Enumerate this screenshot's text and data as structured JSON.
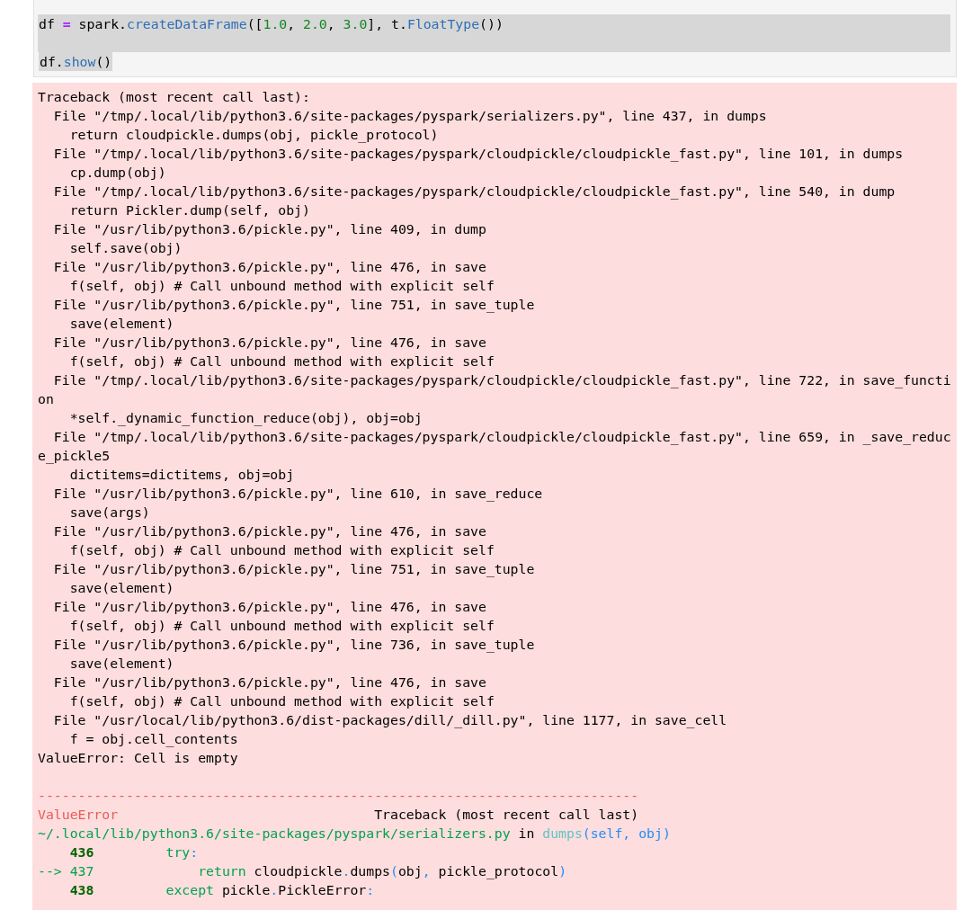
{
  "input_cell": {
    "lines": [
      [
        {
          "text": "df ",
          "kind": "plain"
        },
        {
          "text": "=",
          "kind": "operator"
        },
        {
          "text": " spark.",
          "kind": "plain"
        },
        {
          "text": "createDataFrame",
          "kind": "name"
        },
        {
          "text": "([",
          "kind": "plain"
        },
        {
          "text": "1.0",
          "kind": "number"
        },
        {
          "text": ", ",
          "kind": "plain"
        },
        {
          "text": "2.0",
          "kind": "number"
        },
        {
          "text": ", ",
          "kind": "plain"
        },
        {
          "text": "3.0",
          "kind": "number"
        },
        {
          "text": "], t.",
          "kind": "plain"
        },
        {
          "text": "FloatType",
          "kind": "name"
        },
        {
          "text": "())",
          "kind": "plain"
        }
      ],
      [
        {
          "text": "df.",
          "kind": "plain"
        },
        {
          "text": "show",
          "kind": "name"
        },
        {
          "text": "()",
          "kind": "plain"
        }
      ]
    ]
  },
  "error_output": {
    "traceback": [
      "Traceback (most recent call last):",
      "  File \"/tmp/.local/lib/python3.6/site-packages/pyspark/serializers.py\", line 437, in dumps",
      "    return cloudpickle.dumps(obj, pickle_protocol)",
      "  File \"/tmp/.local/lib/python3.6/site-packages/pyspark/cloudpickle/cloudpickle_fast.py\", line 101, in dumps",
      "    cp.dump(obj)",
      "  File \"/tmp/.local/lib/python3.6/site-packages/pyspark/cloudpickle/cloudpickle_fast.py\", line 540, in dump",
      "    return Pickler.dump(self, obj)",
      "  File \"/usr/lib/python3.6/pickle.py\", line 409, in dump",
      "    self.save(obj)",
      "  File \"/usr/lib/python3.6/pickle.py\", line 476, in save",
      "    f(self, obj) # Call unbound method with explicit self",
      "  File \"/usr/lib/python3.6/pickle.py\", line 751, in save_tuple",
      "    save(element)",
      "  File \"/usr/lib/python3.6/pickle.py\", line 476, in save",
      "    f(self, obj) # Call unbound method with explicit self",
      "  File \"/tmp/.local/lib/python3.6/site-packages/pyspark/cloudpickle/cloudpickle_fast.py\", line 722, in save_function",
      "    *self._dynamic_function_reduce(obj), obj=obj",
      "  File \"/tmp/.local/lib/python3.6/site-packages/pyspark/cloudpickle/cloudpickle_fast.py\", line 659, in _save_reduce_pickle5",
      "    dictitems=dictitems, obj=obj",
      "  File \"/usr/lib/python3.6/pickle.py\", line 610, in save_reduce",
      "    save(args)",
      "  File \"/usr/lib/python3.6/pickle.py\", line 476, in save",
      "    f(self, obj) # Call unbound method with explicit self",
      "  File \"/usr/lib/python3.6/pickle.py\", line 751, in save_tuple",
      "    save(element)",
      "  File \"/usr/lib/python3.6/pickle.py\", line 476, in save",
      "    f(self, obj) # Call unbound method with explicit self",
      "  File \"/usr/lib/python3.6/pickle.py\", line 736, in save_tuple",
      "    save(element)",
      "  File \"/usr/lib/python3.6/pickle.py\", line 476, in save",
      "    f(self, obj) # Call unbound method with explicit self",
      "  File \"/usr/local/lib/python3.6/dist-packages/dill/_dill.py\", line 1177, in save_cell",
      "    f = obj.cell_contents",
      "ValueError: Cell is empty"
    ],
    "colored_lines": [
      [
        {
          "text": "---------------------------------------------------------------------------",
          "kind": "red"
        }
      ],
      [
        {
          "text": "ValueError",
          "kind": "red"
        },
        {
          "text": "                                Traceback (most recent call last)",
          "kind": "plain"
        }
      ],
      [
        {
          "text": "~/.local/lib/python3.6/site-packages/pyspark/serializers.py",
          "kind": "green"
        },
        {
          "text": " in ",
          "kind": "plain"
        },
        {
          "text": "dumps",
          "kind": "cyan"
        },
        {
          "text": "(self, obj)",
          "kind": "blue"
        }
      ],
      [
        {
          "text": "    436",
          "kind": "lineno"
        },
        {
          "text": "         try",
          "kind": "green"
        },
        {
          "text": ":",
          "kind": "blue"
        }
      ],
      [
        {
          "text": "--> 437",
          "kind": "green"
        },
        {
          "text": "             return",
          "kind": "green"
        },
        {
          "text": " cloudpickle",
          "kind": "plain"
        },
        {
          "text": ".",
          "kind": "blue"
        },
        {
          "text": "dumps",
          "kind": "plain"
        },
        {
          "text": "(",
          "kind": "blue"
        },
        {
          "text": "obj",
          "kind": "plain"
        },
        {
          "text": ",",
          "kind": "blue"
        },
        {
          "text": " pickle_protocol",
          "kind": "plain"
        },
        {
          "text": ")",
          "kind": "blue"
        }
      ],
      [
        {
          "text": "    438",
          "kind": "lineno"
        },
        {
          "text": "         except",
          "kind": "green"
        },
        {
          "text": " pickle",
          "kind": "plain"
        },
        {
          "text": ".",
          "kind": "blue"
        },
        {
          "text": "PickleError",
          "kind": "plain"
        },
        {
          "text": ":",
          "kind": "blue"
        }
      ]
    ]
  }
}
